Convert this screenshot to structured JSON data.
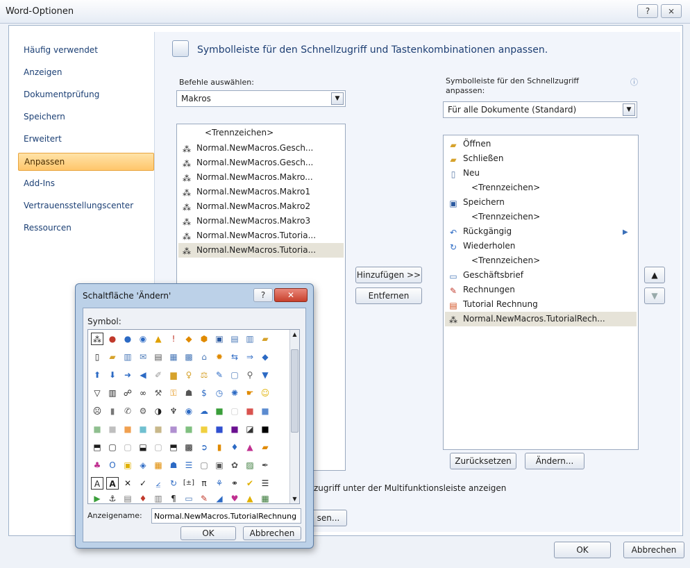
{
  "window": {
    "title": "Word-Optionen",
    "help_glyph": "?",
    "close_glyph": "⨯"
  },
  "nav": {
    "items": [
      {
        "label": "Häufig verwendet"
      },
      {
        "label": "Anzeigen"
      },
      {
        "label": "Dokumentprüfung"
      },
      {
        "label": "Speichern"
      },
      {
        "label": "Erweitert"
      },
      {
        "label": "Anpassen",
        "selected": true
      },
      {
        "label": "Add-Ins"
      },
      {
        "label": "Vertrauensstellungscenter"
      },
      {
        "label": "Ressourcen"
      }
    ]
  },
  "main": {
    "heading": "Symbolleiste für den Schnellzugriff und Tastenkombinationen anpassen.",
    "commands_label": "Befehle auswählen:",
    "commands_value": "Makros",
    "toolbar_label_1": "Symbolleiste für den Schnellzugriff",
    "toolbar_label_2": "anpassen:",
    "toolbar_value": "Für alle Dokumente (Standard)",
    "info_glyph": "ⓘ",
    "left_list": [
      {
        "label": "<Trennzeichen>",
        "type": "sep"
      },
      {
        "label": "Normal.NewMacros.Gesch...",
        "icon": "macro-icon"
      },
      {
        "label": "Normal.NewMacros.Gesch...",
        "icon": "macro-icon"
      },
      {
        "label": "Normal.NewMacros.Makro...",
        "icon": "macro-icon"
      },
      {
        "label": "Normal.NewMacros.Makro1",
        "icon": "macro-icon"
      },
      {
        "label": "Normal.NewMacros.Makro2",
        "icon": "macro-icon"
      },
      {
        "label": "Normal.NewMacros.Makro3",
        "icon": "macro-icon"
      },
      {
        "label": "Normal.NewMacros.Tutoria...",
        "icon": "macro-icon"
      },
      {
        "label": "Normal.NewMacros.Tutoria...",
        "icon": "macro-icon",
        "selected": true
      }
    ],
    "right_list": [
      {
        "label": "Öffnen",
        "icon": "folder-open-icon"
      },
      {
        "label": "Schließen",
        "icon": "folder-close-icon"
      },
      {
        "label": "Neu",
        "icon": "new-document-icon"
      },
      {
        "label": "<Trennzeichen>",
        "type": "sep"
      },
      {
        "label": "Speichern",
        "icon": "save-icon"
      },
      {
        "label": "<Trennzeichen>",
        "type": "sep"
      },
      {
        "label": "Rückgängig",
        "icon": "undo-icon"
      },
      {
        "label": "Wiederholen",
        "icon": "redo-icon"
      },
      {
        "label": "<Trennzeichen>",
        "type": "sep"
      },
      {
        "label": "Geschäftsbrief",
        "icon": "letter-icon"
      },
      {
        "label": "Rechnungen",
        "icon": "invoice-icon"
      },
      {
        "label": "Tutorial Rechnung",
        "icon": "tutorial-icon"
      },
      {
        "label": "Normal.NewMacros.TutorialRech...",
        "icon": "macro-icon",
        "selected": true
      }
    ],
    "add_button": "Hinzufügen >>",
    "remove_button": "Entfernen",
    "reset_button": "Zurücksetzen",
    "modify_button": "Ändern...",
    "show_below_text": "zugriff unter der Multifunktionsleiste anzeigen",
    "customize_button_partial": "sen..."
  },
  "footer": {
    "ok": "OK",
    "cancel": "Abbrechen"
  },
  "dialog": {
    "title": "Schaltfläche 'Ändern'",
    "symbol_label": "Symbol:",
    "display_name_label": "Anzeigename:",
    "display_name_value": "Normal.NewMacros.TutorialRechnung",
    "ok": "OK",
    "cancel": "Abbrechen",
    "close_glyph": "✕",
    "help_glyph": "?"
  }
}
